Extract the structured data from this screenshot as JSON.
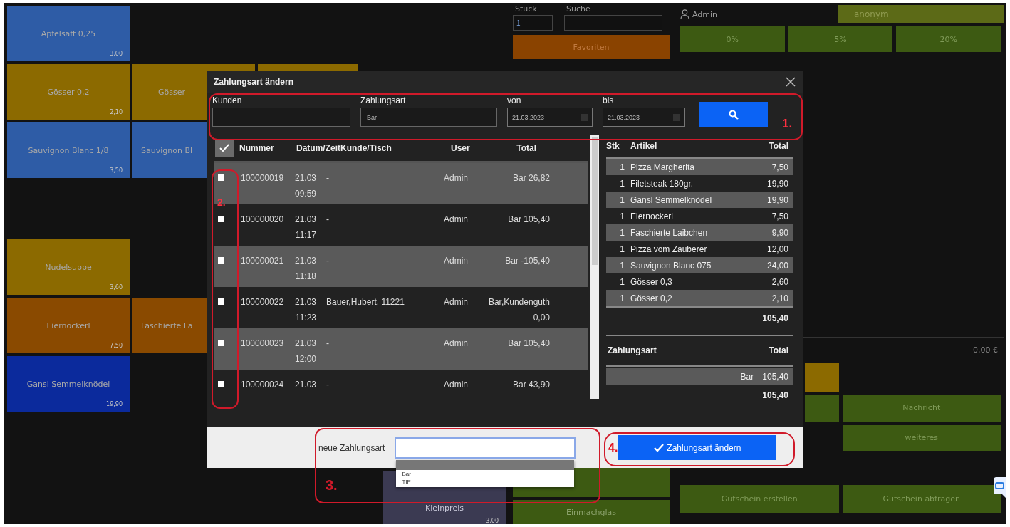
{
  "tiles": [
    {
      "label": "Apfelsaft 0,25",
      "price": "3,00",
      "color": "#2e5ca6"
    },
    {
      "label": "Gösser 0,2",
      "price": "2,10",
      "color": "#8c6a00"
    },
    {
      "label": "Gösser",
      "color": "#8c6a00"
    },
    {
      "color": "#8c6a00"
    },
    {
      "label": "Sauvignon Blanc 1/8",
      "price": "3,50",
      "color": "#2e5ca6"
    },
    {
      "label": "Sauvignon Bl",
      "color": "#2e5ca6"
    },
    {
      "label": "Nudelsuppe",
      "price": "3,60",
      "color": "#8c6a00"
    },
    {
      "label": "Eiernockerl",
      "price": "7,50",
      "color": "#8a4a00"
    },
    {
      "label": "Faschierte La",
      "color": "#8a4a00"
    },
    {
      "label": "Gansl Semmelknödel",
      "price": "19,90",
      "color": "#0b2a9c"
    },
    {
      "label": "Kleinpreis",
      "price": "3,00",
      "color": "#3b3a52"
    }
  ],
  "quantity": {
    "label": "Stück",
    "value": "1"
  },
  "search": {
    "label": "Suche"
  },
  "favorites_button": "Favoriten",
  "middle_tiles": [
    {
      "color": "#3d5a12"
    },
    {
      "label": "Einmachglas",
      "color": "#3d5a12"
    }
  ],
  "user": "Admin",
  "customer": "anonym",
  "tax_rates": [
    {
      "label": "0%"
    },
    {
      "label": "5%"
    },
    {
      "label": "20%"
    }
  ],
  "sum": "0,00 €",
  "right_tiles": [
    {
      "color": "#8c6a00"
    },
    {
      "color": "#3d5a12"
    },
    {
      "label": "Nachricht",
      "color": "#3d5a12"
    },
    {
      "label": "weiteres",
      "color": "#3d5a12"
    },
    {
      "label": "Gutschein erstellen",
      "color": "#3d5a12"
    },
    {
      "label": "Gutschein abfragen",
      "color": "#3d5a12"
    }
  ],
  "dialog": {
    "title": "Zahlungsart ändern",
    "filters": [
      {
        "label": "Kunden",
        "kind": "text"
      },
      {
        "label": "Zahlungsart",
        "kind": "text",
        "value": "Bar"
      },
      {
        "label": "von",
        "kind": "date",
        "value": "21.03.2023"
      },
      {
        "label": "bis",
        "kind": "date",
        "value": "21.03.2023"
      }
    ],
    "receipts": {
      "all_checked": true,
      "columns": [
        "Nummer",
        "Datum/Zeit",
        "Kunde/Tisch",
        "User",
        "Total"
      ],
      "rows": [
        {
          "checked": false,
          "number": "100000019",
          "date": "21.03",
          "time": "09:59",
          "customer": "-",
          "user": "Admin",
          "total": "Bar 26,82"
        },
        {
          "checked": false,
          "number": "100000020",
          "date": "21.03",
          "time": "11:17",
          "customer": "-",
          "user": "Admin",
          "total": "Bar 105,40"
        },
        {
          "checked": false,
          "number": "100000021",
          "date": "21.03",
          "time": "11:18",
          "customer": "-",
          "user": "Admin",
          "total": "Bar -105,40"
        },
        {
          "checked": false,
          "number": "100000022",
          "date": "21.03",
          "time": "11:23",
          "customer": "Bauer,Hubert, 11221",
          "user": "Admin",
          "total": "Bar,Kundenguth",
          "total_2": "0,00"
        },
        {
          "checked": false,
          "number": "100000023",
          "date": "21.03",
          "time": "12:00",
          "customer": "-",
          "user": "Admin",
          "total": "Bar 105,40"
        },
        {
          "checked": false,
          "number": "100000024",
          "date": "21.03",
          "customer": "-",
          "user": "Admin",
          "total": "Bar 43,90"
        }
      ]
    },
    "details": {
      "columns": [
        "Stk",
        "Artikel",
        "Total"
      ],
      "items": [
        {
          "qty": "1",
          "name": "Pizza Margherita",
          "total": "7,50"
        },
        {
          "qty": "1",
          "name": "Filetsteak 180gr.",
          "total": "19,90"
        },
        {
          "qty": "1",
          "name": "Gansl Semmelknödel",
          "total": "19,90"
        },
        {
          "qty": "1",
          "name": "Eiernockerl",
          "total": "7,50"
        },
        {
          "qty": "1",
          "name": "Faschierte Laibchen",
          "total": "9,90"
        },
        {
          "qty": "1",
          "name": "Pizza vom Zauberer",
          "total": "12,00"
        },
        {
          "qty": "1",
          "name": "Sauvignon Blanc 075",
          "total": "24,00"
        },
        {
          "qty": "1",
          "name": "Gösser 0,3",
          "total": "2,60"
        },
        {
          "qty": "1",
          "name": "Gösser 0,2",
          "total": "2,10"
        }
      ],
      "total": "105,40",
      "payment_columns": [
        "Zahlungsart",
        "Total"
      ],
      "payments": [
        {
          "method": "Bar",
          "total": "105,40"
        }
      ],
      "payments_total": "105,40"
    },
    "new_payment": {
      "label": "neue Zahlungsart",
      "open": true,
      "options": [
        {
          "selected": true
        },
        {
          "label": "Bar",
          "selected": false
        },
        {
          "label": "TIP",
          "selected": false
        }
      ]
    },
    "submit_button": "Zahlungsart ändern"
  },
  "annotations": [
    {
      "label": "1."
    },
    {
      "label": "2."
    },
    {
      "label": "3."
    },
    {
      "label": "4."
    }
  ]
}
